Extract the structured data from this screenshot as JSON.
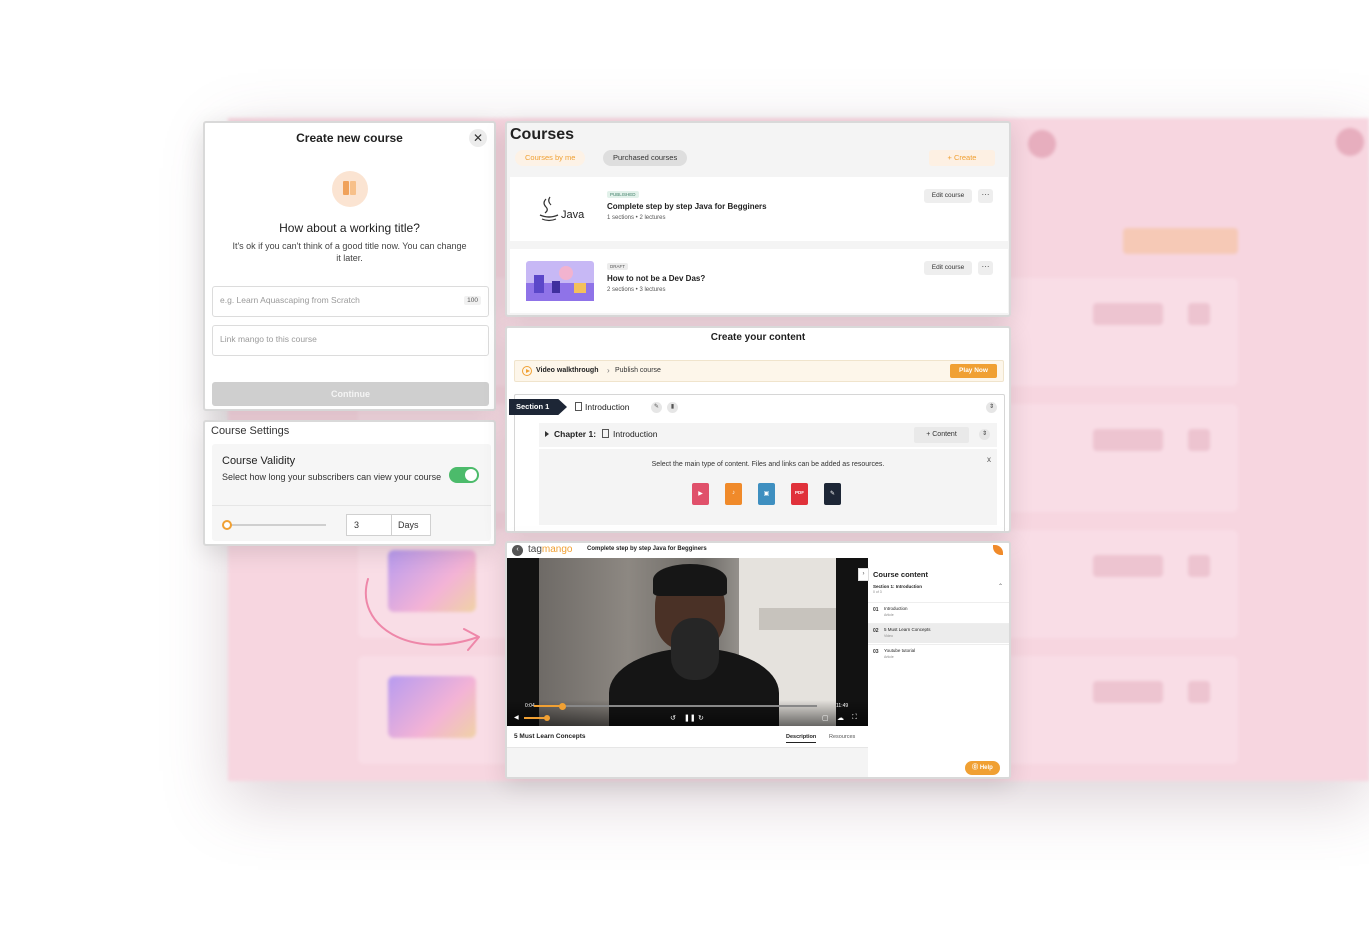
{
  "create_course": {
    "title": "Create new course",
    "close_glyph": "✕",
    "headline": "How about a working title?",
    "subtext": "It's ok if you can't think of a good title now. You can change it later.",
    "title_placeholder": "e.g. Learn Aquascaping from Scratch",
    "char_limit": "100",
    "mango_placeholder": "Link mango to this course",
    "continue_label": "Continue"
  },
  "course_settings": {
    "heading": "Course Settings",
    "validity_title": "Course Validity",
    "validity_desc": "Select how long your subscribers can view your course",
    "toggle_on": true,
    "days_value": "3",
    "days_unit": "Days",
    "slider_fraction": 0.0
  },
  "courses": {
    "title": "Courses",
    "tabs": [
      {
        "label": "Courses by me",
        "active": true
      },
      {
        "label": "Purchased courses",
        "active": false
      }
    ],
    "create_label": "+ Create",
    "items": [
      {
        "badge": "PUBLISHED",
        "title": "Complete step by step Java for Begginers",
        "meta": "1 sections • 2 lectures",
        "edit_label": "Edit course",
        "more_glyph": "···",
        "logo": "Java"
      },
      {
        "badge": "DRAFT",
        "title": "How to not be a Dev Das?",
        "meta": "2 sections • 3 lectures",
        "edit_label": "Edit course",
        "more_glyph": "···"
      }
    ]
  },
  "content_builder": {
    "title": "Create your content",
    "walkthrough_label": "Video walkthrough",
    "walkthrough_sep": "›",
    "walkthrough_step": "Publish course",
    "play_now_label": "Play Now",
    "section_tag": "Section 1",
    "section_name": "Introduction",
    "chapter_label": "Chapter 1:",
    "chapter_name": "Introduction",
    "add_content_label": "+ Content",
    "type_prompt": "Select the main type of content. Files and links can be added as resources.",
    "close_glyph": "x",
    "content_types": [
      {
        "icon": "video-file-icon",
        "color": "#e0506a",
        "glyph": "▶"
      },
      {
        "icon": "audio-file-icon",
        "color": "#f08a2a",
        "glyph": "♪"
      },
      {
        "icon": "image-file-icon",
        "color": "#3e8fc0",
        "glyph": "▣"
      },
      {
        "icon": "pdf-file-icon",
        "color": "#e0313a",
        "glyph": "PDF"
      },
      {
        "icon": "article-icon",
        "color": "#1d2636",
        "glyph": "✎"
      }
    ]
  },
  "player": {
    "brand_prefix": "tag",
    "brand_suffix": "mango",
    "course_title": "Complete step by step Java for Begginers",
    "time_current": "0:04",
    "time_total": "11:49",
    "progress_fraction": 0.1,
    "lesson_title": "5 Must Learn Concepts",
    "tab_description": "Description",
    "tab_resources": "Resources",
    "sidebar": {
      "title": "Course content",
      "section": "Section 1: Introduction",
      "progress": "0 of 3",
      "lessons": [
        {
          "num": "01",
          "title": "Introduction",
          "kind": "Article",
          "active": false
        },
        {
          "num": "02",
          "title": "5 Must Learn Concepts",
          "kind": "Video",
          "active": true
        },
        {
          "num": "03",
          "title": "Youtube tutorial",
          "kind": "Article",
          "active": false
        }
      ]
    },
    "help_label": "⓪ Help"
  },
  "colors": {
    "accent": "#f0a033",
    "background_app": "#f7d6e0",
    "toggle_on": "#4cbb6b",
    "section_tag": "#1d2636"
  }
}
